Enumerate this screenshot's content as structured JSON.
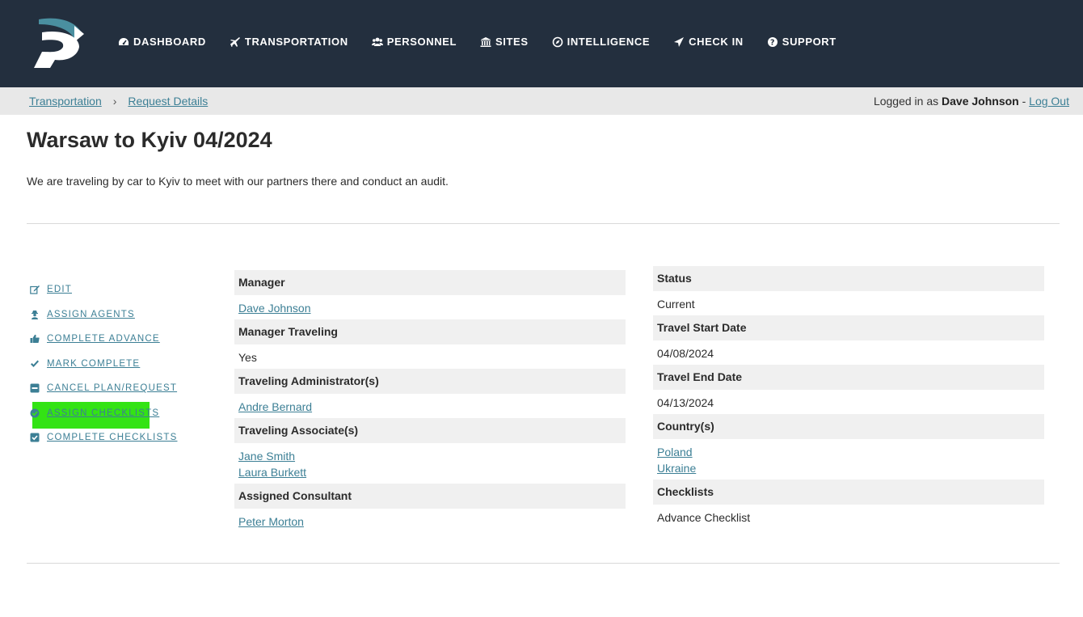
{
  "nav": {
    "logo": "p-logo",
    "items": [
      {
        "label": "DASHBOARD",
        "icon": "dashboard-icon"
      },
      {
        "label": "TRANSPORTATION",
        "icon": "plane-icon"
      },
      {
        "label": "PERSONNEL",
        "icon": "users-icon"
      },
      {
        "label": "SITES",
        "icon": "bank-icon"
      },
      {
        "label": "INTELLIGENCE",
        "icon": "compass-icon"
      },
      {
        "label": "CHECK IN",
        "icon": "location-arrow-icon"
      },
      {
        "label": "SUPPORT",
        "icon": "question-circle-icon"
      }
    ]
  },
  "breadcrumb": {
    "items": [
      "Transportation",
      "Request Details"
    ],
    "separator": "›"
  },
  "login": {
    "prefix": "Logged in as",
    "user": "Dave Johnson",
    "dash": "-",
    "logout": "Log Out"
  },
  "page": {
    "title": "Warsaw to Kyiv 04/2024",
    "description": "We are traveling by car to Kyiv to meet with our partners there and conduct an audit."
  },
  "actions": [
    {
      "label": "EDIT",
      "icon": "edit-icon"
    },
    {
      "label": "ASSIGN AGENTS",
      "icon": "user-secret-icon"
    },
    {
      "label": "COMPLETE ADVANCE",
      "icon": "thumbs-up-icon"
    },
    {
      "label": "MARK COMPLETE",
      "icon": "check-icon"
    },
    {
      "label": "CANCEL PLAN/REQUEST",
      "icon": "minus-square-icon"
    },
    {
      "label": "ASSIGN CHECKLISTS",
      "icon": "check-circle-icon",
      "highlighted": true
    },
    {
      "label": "COMPLETE CHECKLISTS",
      "icon": "check-square-icon"
    }
  ],
  "details_left": {
    "manager": {
      "label": "Manager",
      "value": "Dave Johnson"
    },
    "manager_traveling": {
      "label": "Manager Traveling",
      "value": "Yes"
    },
    "admins": {
      "label": "Traveling Administrator(s)",
      "values": [
        "Andre Bernard"
      ]
    },
    "associates": {
      "label": "Traveling Associate(s)",
      "values": [
        "Jane Smith",
        "Laura Burkett"
      ]
    },
    "consultant": {
      "label": "Assigned Consultant",
      "value": "Peter Morton"
    }
  },
  "details_right": {
    "status": {
      "label": "Status",
      "value": "Current"
    },
    "start": {
      "label": "Travel Start Date",
      "value": "04/08/2024"
    },
    "end": {
      "label": "Travel End Date",
      "value": "04/13/2024"
    },
    "countries": {
      "label": "Country(s)",
      "values": [
        "Poland",
        "Ukraine"
      ]
    },
    "checklists": {
      "label": "Checklists",
      "value": "Advance Checklist"
    }
  },
  "colors": {
    "topbar": "#232f3e",
    "link": "#3c7f95",
    "highlight": "#33e314",
    "logo_teal": "#4a8fa0"
  }
}
